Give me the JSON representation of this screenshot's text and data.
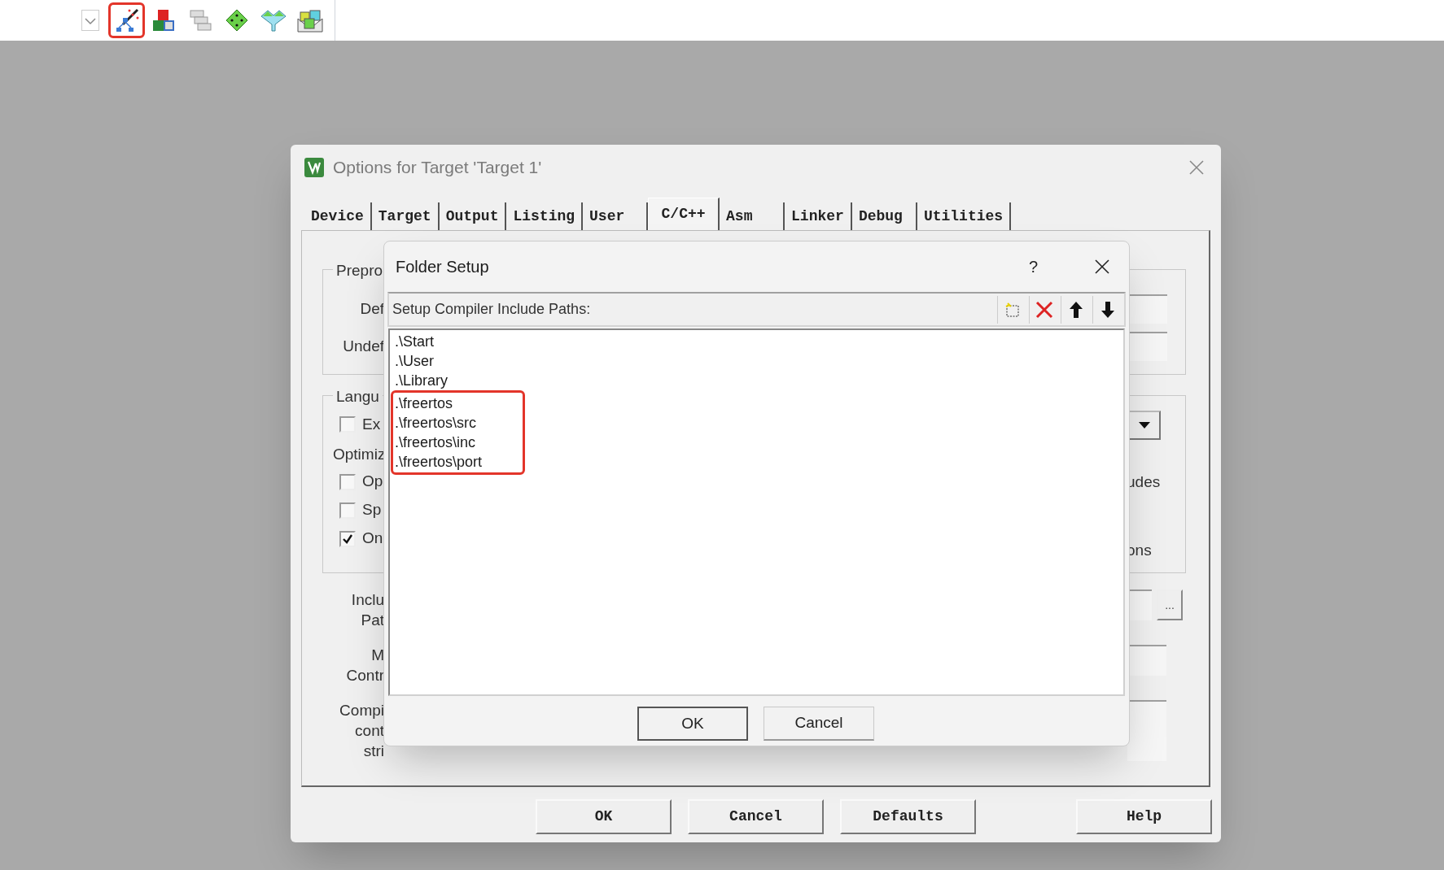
{
  "toolbar": {
    "buttons": [
      {
        "kind": "dropdown",
        "highlighted": false
      },
      {
        "kind": "wand",
        "highlighted": true
      },
      {
        "kind": "blocks",
        "highlighted": false
      },
      {
        "kind": "stack",
        "highlighted": false
      },
      {
        "kind": "diamond",
        "highlighted": false
      },
      {
        "kind": "funnel",
        "highlighted": false
      },
      {
        "kind": "package",
        "highlighted": false
      }
    ]
  },
  "options_dialog": {
    "title": "Options for Target 'Target 1'",
    "tabs": [
      {
        "label": "Device",
        "selected": false
      },
      {
        "label": "Target",
        "selected": false
      },
      {
        "label": "Output",
        "selected": false
      },
      {
        "label": "Listing",
        "selected": false
      },
      {
        "label": "User",
        "selected": false
      },
      {
        "label": "C/C++",
        "selected": true
      },
      {
        "label": "Asm",
        "selected": false
      },
      {
        "label": "Linker",
        "selected": false
      },
      {
        "label": "Debug",
        "selected": false
      },
      {
        "label": "Utilities",
        "selected": false
      }
    ],
    "preprocessor": {
      "legend": "Prepro",
      "rows": [
        "Def",
        "Undef"
      ]
    },
    "language": {
      "legend": "Langu",
      "first_checkbox": {
        "label": "Ex",
        "checked": false
      },
      "optimization_label": "Optimiz",
      "checkboxes": [
        {
          "label": "Op",
          "checked": false
        },
        {
          "label": "Sp",
          "checked": false
        },
        {
          "label": "On",
          "checked": true
        }
      ],
      "right_texts": [
        "udes",
        "ons"
      ]
    },
    "lower_labels": [
      {
        "lines": [
          "Inclu",
          "Pat"
        ],
        "browse": "..."
      },
      {
        "lines": [
          "M",
          "Contr"
        ]
      },
      {
        "lines": [
          "Compi",
          "cont",
          "stri"
        ]
      }
    ],
    "buttons": [
      "OK",
      "Cancel",
      "Defaults",
      "Help"
    ]
  },
  "folder_setup": {
    "title": "Folder Setup",
    "help": "?",
    "header": "Setup Compiler Include Paths:",
    "tools": [
      {
        "kind": "new"
      },
      {
        "kind": "delete"
      },
      {
        "kind": "up"
      },
      {
        "kind": "down"
      }
    ],
    "paths": [
      {
        "text": ".\\Start",
        "highlighted": false
      },
      {
        "text": ".\\User",
        "highlighted": false
      },
      {
        "text": ".\\Library",
        "highlighted": false
      },
      {
        "text": ".\\freertos",
        "highlighted": true
      },
      {
        "text": ".\\freertos\\src",
        "highlighted": true
      },
      {
        "text": ".\\freertos\\inc",
        "highlighted": true
      },
      {
        "text": ".\\freertos\\port",
        "highlighted": true
      }
    ],
    "buttons": [
      {
        "label": "OK",
        "default": true
      },
      {
        "label": "Cancel",
        "default": false
      }
    ]
  }
}
